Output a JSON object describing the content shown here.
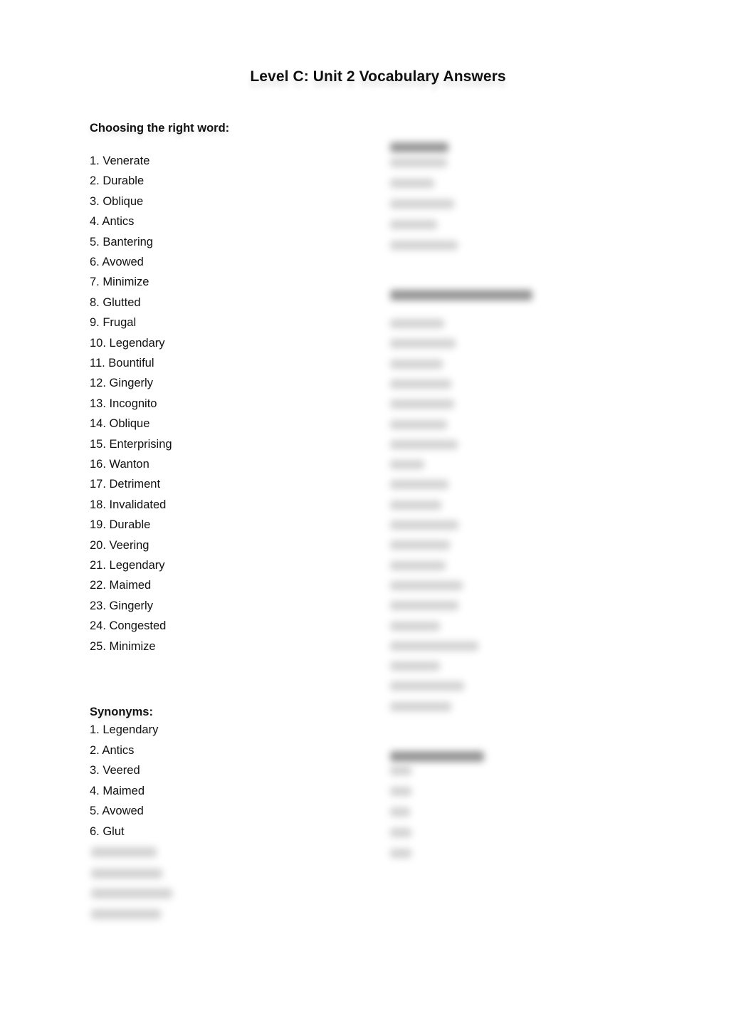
{
  "document": {
    "title": "Level C:  Unit 2 Vocabulary Answers"
  },
  "choosing_the_right_word": {
    "heading": "Choosing the right word:",
    "items": [
      "1. Venerate",
      "2. Durable",
      "3. Oblique",
      "4. Antics",
      "5. Bantering",
      "6. Avowed",
      "7. Minimize",
      "8. Glutted",
      "9. Frugal",
      "10. Legendary",
      "11. Bountiful",
      "12. Gingerly",
      "13. Incognito",
      "14. Oblique",
      "15. Enterprising",
      "16. Wanton",
      "17. Detriment",
      "18. Invalidated",
      "19. Durable",
      "20. Veering",
      "21. Legendary",
      "22. Maimed",
      "23. Gingerly",
      "24. Congested",
      "25. Minimize"
    ]
  },
  "synonyms": {
    "heading": "Synonyms:",
    "items": [
      "1. Legendary",
      "2. Antics",
      "3. Veered",
      "4. Maimed",
      "5. Avowed",
      "6. Glut"
    ],
    "blurred_item_count": 4
  },
  "right_column": {
    "blurred": true,
    "sections": [
      {
        "blurred_item_count": 5
      },
      {
        "blurred_item_count": 20
      },
      {
        "blurred_item_count": 5
      }
    ]
  }
}
